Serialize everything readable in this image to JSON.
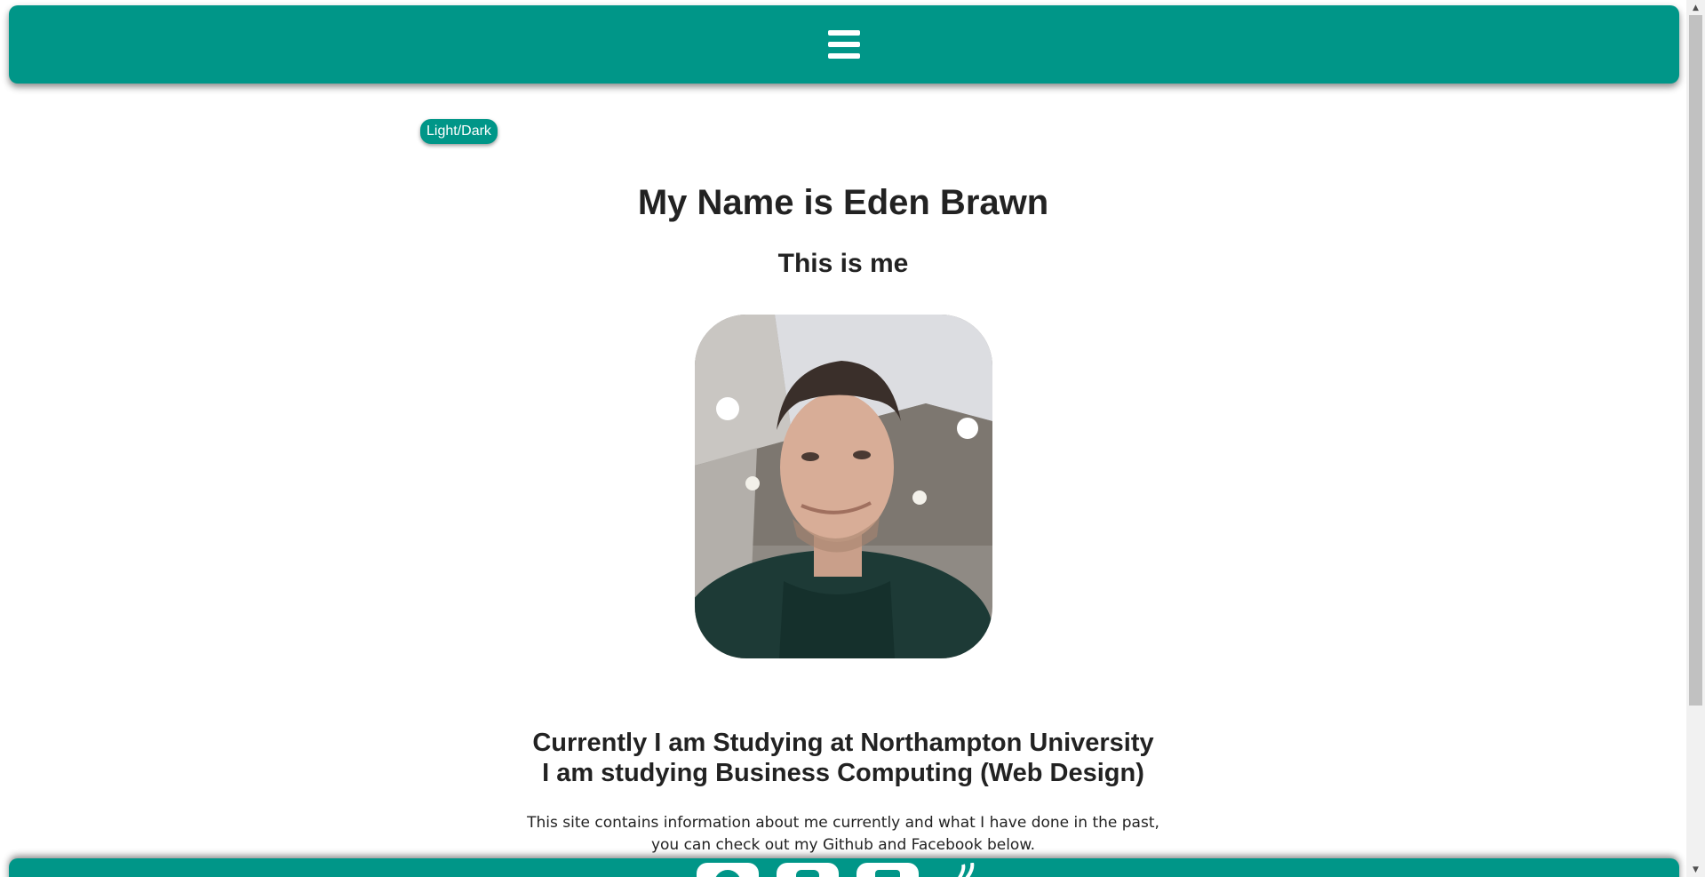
{
  "header": {
    "menu_icon": "hamburger-menu-icon"
  },
  "theme_toggle": {
    "label": "Light/Dark"
  },
  "main": {
    "title": "My Name is Eden Brawn",
    "subtitle": "This is me",
    "photo_icon": "profile-photo",
    "study_line1": "Currently I am Studying at Northampton University",
    "study_line2": "I am studying Business Computing (Web Design)",
    "intro_line1": "This site contains information about me currently and what I have done in the past,",
    "intro_line2": "you can check out my Github and Facebook below."
  },
  "footer": {
    "icons": [
      "github-icon",
      "facebook-icon",
      "linkedin-icon",
      "feed-icon"
    ]
  },
  "colors": {
    "accent": "#009688",
    "text": "#222222",
    "background": "#ffffff"
  }
}
